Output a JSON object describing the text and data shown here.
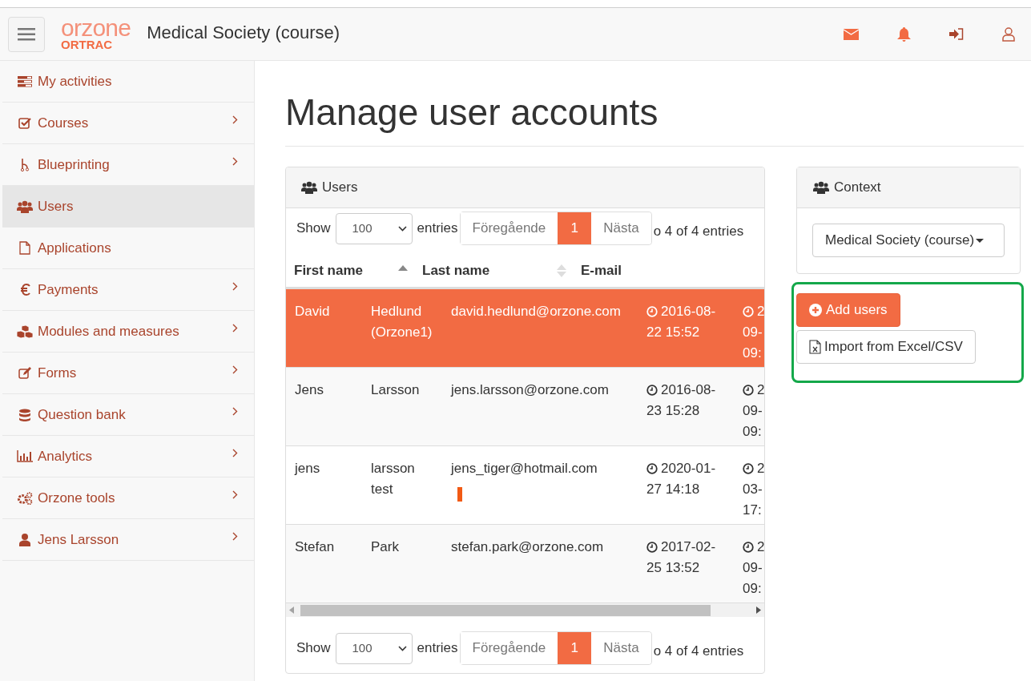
{
  "header": {
    "logo_text": "orzone",
    "logo_subtext": "ORTRAC",
    "title": "Medical Society (course)"
  },
  "sidebar": {
    "items": [
      {
        "label": "My activities",
        "selected": false,
        "chevron": false
      },
      {
        "label": "Courses",
        "selected": false,
        "chevron": true
      },
      {
        "label": "Blueprinting",
        "selected": false,
        "chevron": true
      },
      {
        "label": "Users",
        "selected": true,
        "chevron": false
      },
      {
        "label": "Applications",
        "selected": false,
        "chevron": false
      },
      {
        "label": "Payments",
        "selected": false,
        "chevron": true
      },
      {
        "label": "Modules and measures",
        "selected": false,
        "chevron": true
      },
      {
        "label": "Forms",
        "selected": false,
        "chevron": true
      },
      {
        "label": "Question bank",
        "selected": false,
        "chevron": true
      },
      {
        "label": "Analytics",
        "selected": false,
        "chevron": true
      },
      {
        "label": "Orzone tools",
        "selected": false,
        "chevron": true
      },
      {
        "label": "Jens Larsson",
        "selected": false,
        "chevron": true
      }
    ]
  },
  "page_title": "Manage user accounts",
  "users_panel": {
    "title": "Users",
    "top_controls": {
      "show_label": "Show",
      "page_size": "100",
      "entries_label": "entries",
      "previous": "Föregående",
      "page": "1",
      "next": "Nästa",
      "info": "o 4 of 4 entries"
    },
    "table": {
      "columns": [
        {
          "label": "First name",
          "sorted": true
        },
        {
          "label": "Last name",
          "sorted": false
        },
        {
          "label": "E-mail"
        }
      ],
      "rows": [
        {
          "selected": true,
          "marker": false,
          "first_name": "David",
          "last_name": "Hedlund (Orzone1)",
          "email": "david.hedlund@orzone.com",
          "column_4": "2016-08-22 15:52",
          "column_5": [
            "2",
            "09-",
            "09:"
          ]
        },
        {
          "selected": false,
          "marker": false,
          "first_name": "Jens",
          "last_name": "Larsson",
          "email": "jens.larsson@orzone.com",
          "column_4": "2016-08-23 15:28",
          "column_5": [
            "2",
            "09-",
            "09:"
          ]
        },
        {
          "selected": false,
          "marker": true,
          "first_name": "jens",
          "last_name": "larsson test",
          "email": "jens_tiger@hotmail.com",
          "column_4": "2020-01-27 14:18",
          "column_5": [
            "2",
            "03-",
            "17:"
          ]
        },
        {
          "selected": false,
          "marker": false,
          "first_name": "Stefan",
          "last_name": "Park",
          "email": "stefan.park@orzone.com",
          "column_4": "2017-02-25 13:52",
          "column_5": [
            "2",
            "09-",
            "09:"
          ]
        }
      ]
    },
    "bottom_controls": {
      "show_label": "Show",
      "page_size": "100",
      "entries_label": "entries",
      "previous": "Föregående",
      "page": "1",
      "next": "Nästa",
      "info": "o 4 of 4 entries"
    }
  },
  "context_panel": {
    "title": "Context",
    "dropdown": "Medical Society (course)"
  },
  "actions": {
    "add": "Add users",
    "import": "Import from Excel/CSV"
  }
}
